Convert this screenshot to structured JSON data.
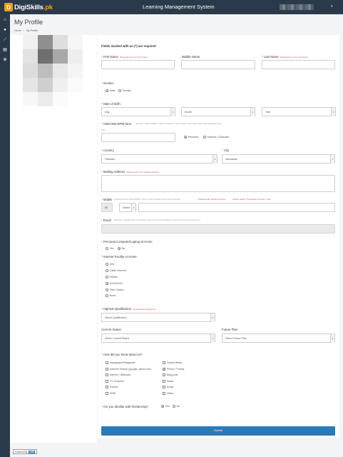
{
  "header": {
    "logo_mark": "D",
    "logo_name": "DigiSkills",
    "logo_suffix": ".pk",
    "app_title": "Learning Management System"
  },
  "sidebar": {
    "icons": [
      "home-icon",
      "user-icon",
      "chart-icon",
      "document-icon",
      "plus-circle-icon"
    ]
  },
  "page": {
    "title": "My Profile",
    "breadcrumb": {
      "home": "Home",
      "separator": "›",
      "current": "My Profile"
    }
  },
  "form": {
    "required_note": "Fields marked with an (*) are required",
    "first_name": {
      "label": "First Name",
      "hint": "Please Enter Your First Name",
      "value": ""
    },
    "middle_name": {
      "label": "Middle Name",
      "value": ""
    },
    "last_name": {
      "label": "Last Name",
      "hint": "Please Enter Your Last Name",
      "value": ""
    },
    "gender": {
      "label": "Gender",
      "options": [
        "Male",
        "Female"
      ],
      "selected": "Male"
    },
    "dob": {
      "label": "Date of Birth",
      "day": "Day",
      "month": "Month",
      "year": "Year"
    },
    "cnic": {
      "label": "CNIC/NICOP/B-form",
      "note": "(Example: 12345-1234567-1 Without dashes). If using a B-form, then enter CNIC of parent/guardian also.",
      "small": "Belo",
      "value": "",
      "options": [
        "Personal",
        "Parents / Guardian"
      ],
      "selected": "Personal"
    },
    "country": {
      "label": "Country",
      "value": "Pakistan"
    },
    "city": {
      "label": "City",
      "value": "Islamabad"
    },
    "mailing_address": {
      "label": "Mailing Address",
      "hint": "Please Enter Your Mailing Address",
      "value": ""
    },
    "mobile": {
      "label": "Mobile",
      "note": "(Verified) (Format: 03001234567 Country Code + Mobile Number, Enter Number)",
      "hint1": "Please Enter Mobile Number",
      "hint2": "Please Select The Mobile operator Code",
      "code": "92",
      "operator": "Select"
    },
    "email": {
      "label": "Email",
      "note": "(Example: email@domain.com) Please make sure that email address is correct and you have access to it.",
      "value": ""
    },
    "computer": {
      "label": "Personal Computer/Laptop at Home",
      "options": [
        "Yes",
        "No"
      ],
      "selected": "No"
    },
    "internet": {
      "label": "Internet Facility At Home",
      "options": [
        "DSL",
        "Cable Internet",
        "WiMax",
        "Evo/3G/4G",
        "Fiber Optics",
        "None"
      ],
      "selected": "Evo/3G/4G"
    },
    "qualification": {
      "label": "Highest Qualification",
      "hint": "(Qualification Required)",
      "value": "Select Qualification"
    },
    "current_status": {
      "label": "Current Status",
      "value": "Select Current Status"
    },
    "future_plan": {
      "label": "Future Plan",
      "value": "Select Future Plan"
    },
    "heard": {
      "label": "How did you know about us?",
      "col1": [
        {
          "label": "Newspaper/Magazine",
          "checked": false
        },
        {
          "label": "Internet Search (google, yahoo etc)",
          "checked": false
        },
        {
          "label": "Banner / Billboard",
          "checked": false
        },
        {
          "label": "TV Channel",
          "checked": false
        },
        {
          "label": "Events",
          "checked": false
        },
        {
          "label": "SMS",
          "checked": false
        }
      ],
      "col2": [
        {
          "label": "Social Media",
          "checked": false
        },
        {
          "label": "Friend / Family",
          "checked": true
        },
        {
          "label": "Blog post",
          "checked": false
        },
        {
          "label": "Radio",
          "checked": false
        },
        {
          "label": "Email",
          "checked": false
        },
        {
          "label": "Other",
          "checked": false
        }
      ]
    },
    "freelancing": {
      "label": "Are you familiar with freelancing?",
      "options": [
        "Yes",
        "No"
      ],
      "selected": "Yes"
    },
    "submit_label": "Submit"
  },
  "footer": {
    "powered_by": "Powered By",
    "badge": "LMS"
  },
  "colors": {
    "topbar": "#2b3a4a",
    "accent": "#2a7ab8",
    "logo_orange": "#f39c12",
    "required": "#d9534f"
  }
}
